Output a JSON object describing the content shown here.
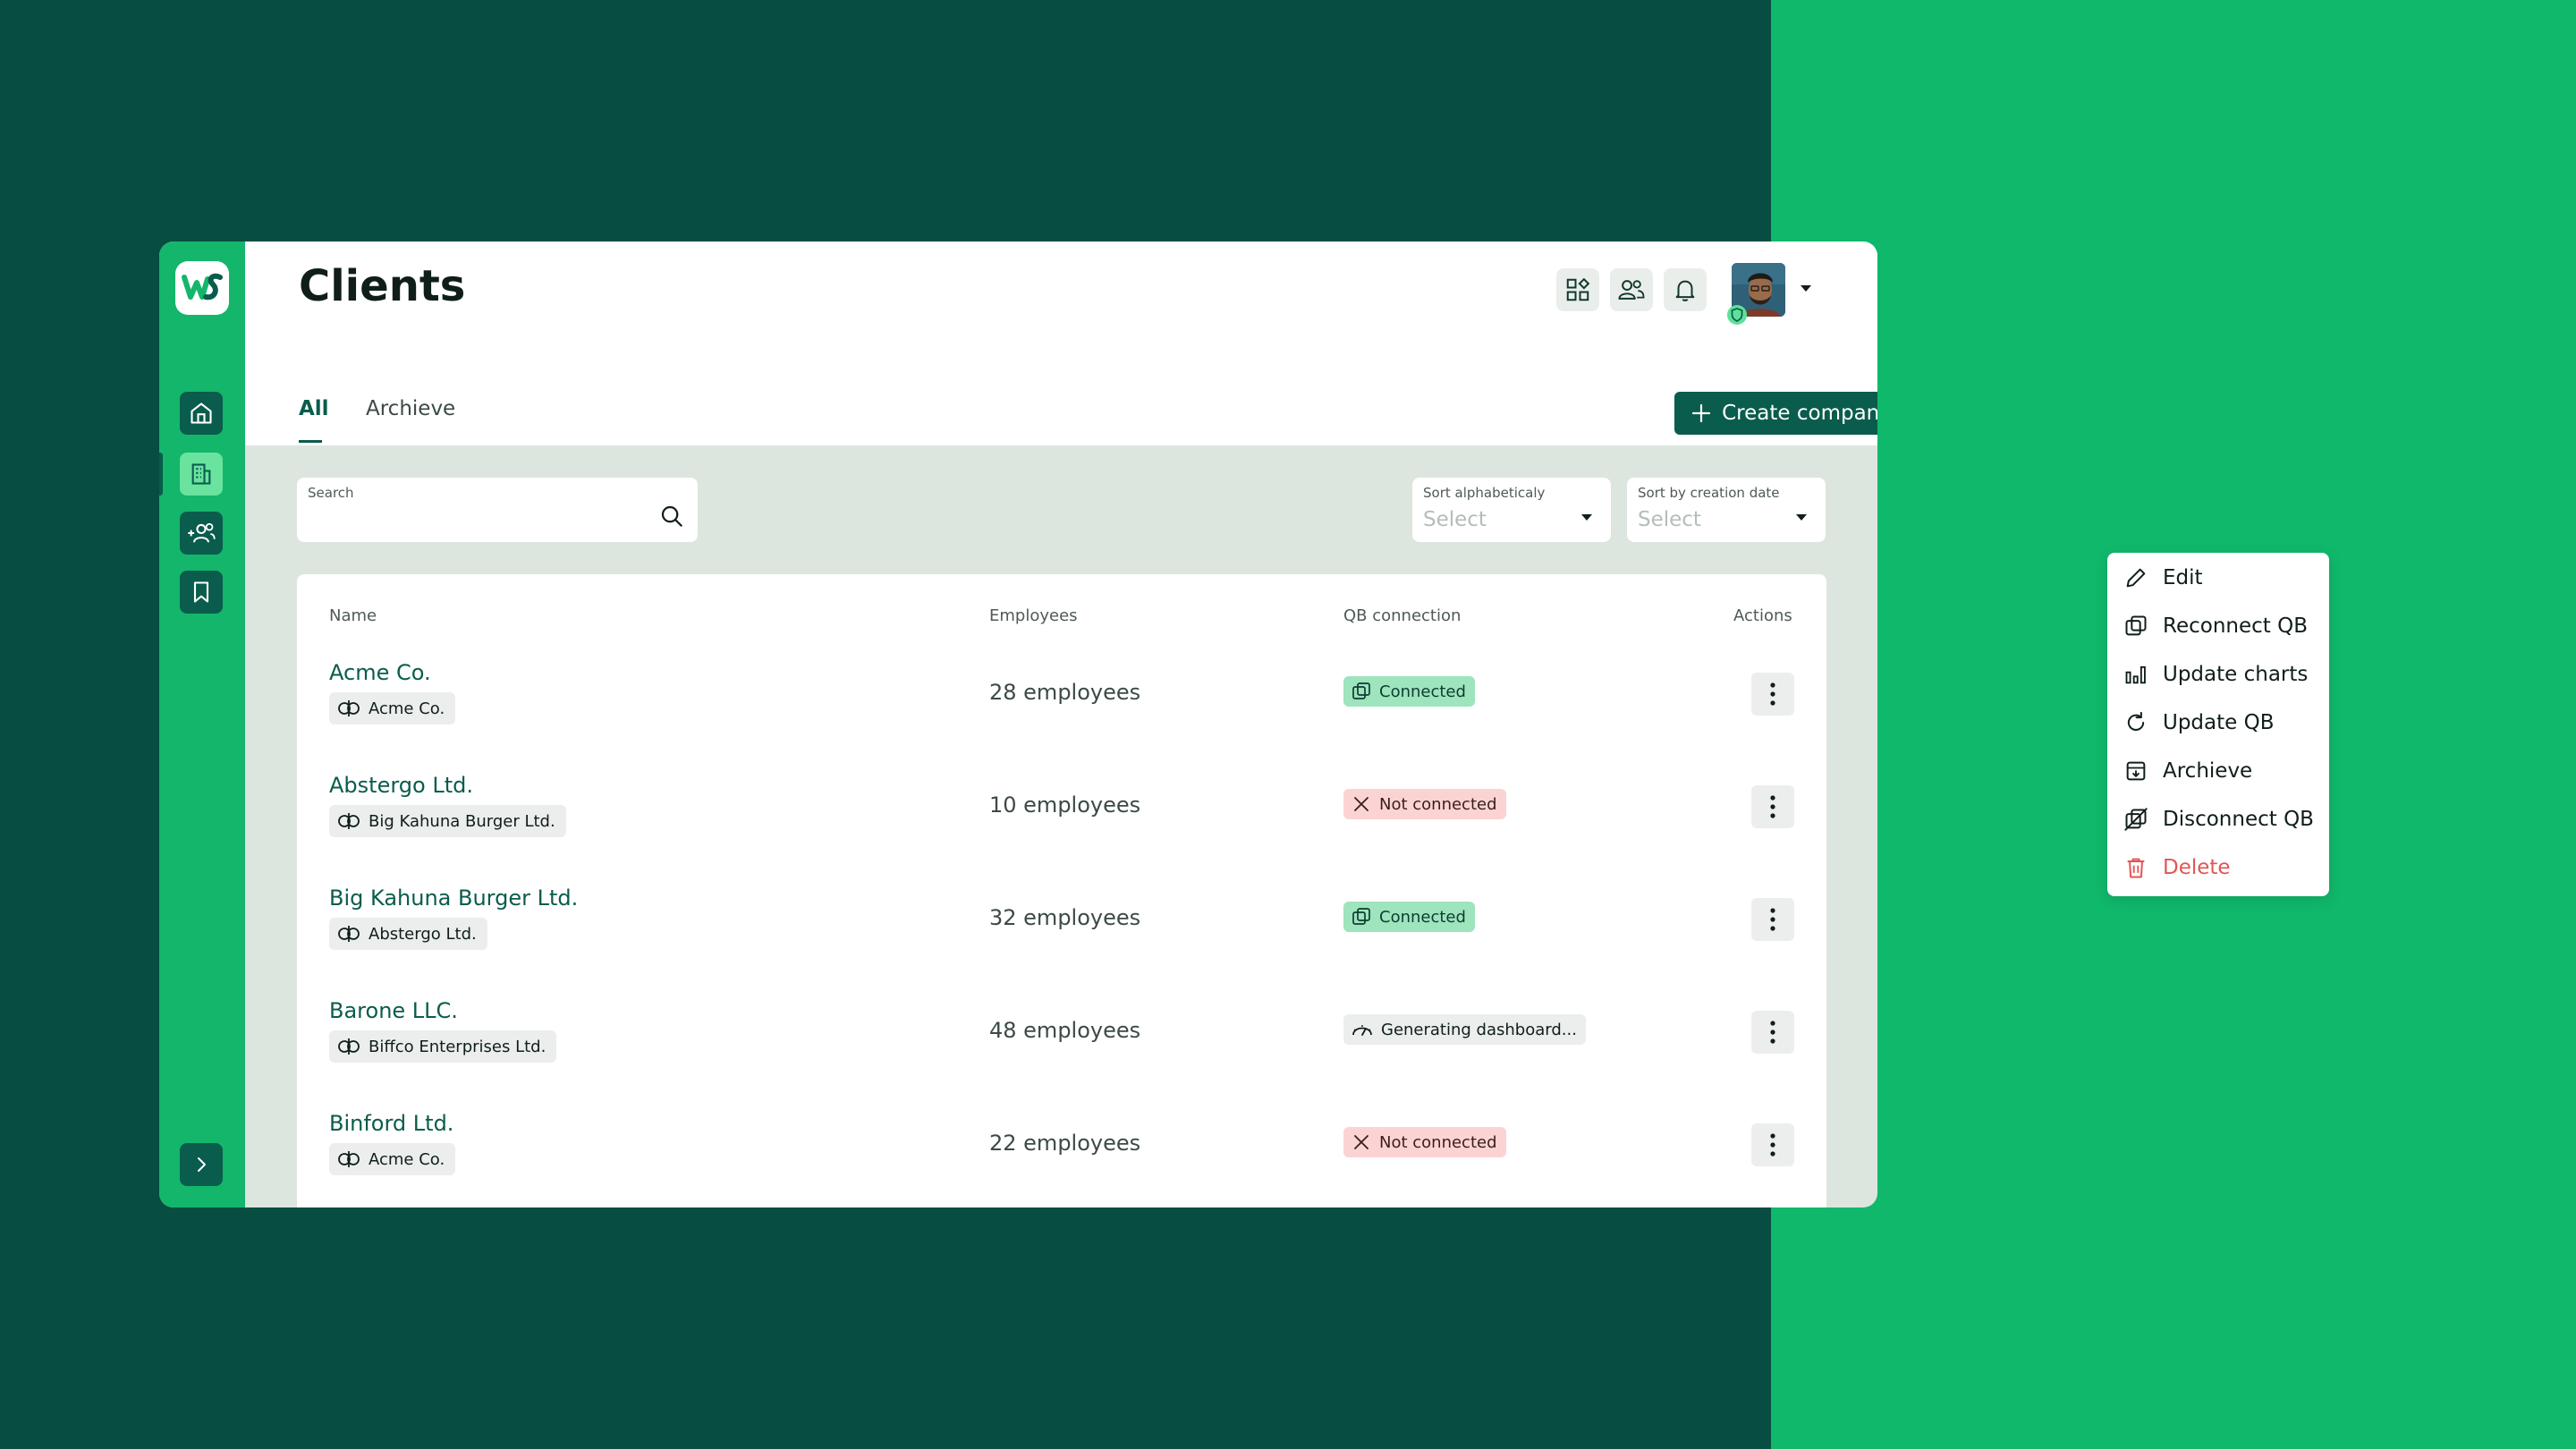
{
  "page": {
    "title": "Clients"
  },
  "header": {
    "icons": [
      "apps-icon",
      "users-icon",
      "bell-icon"
    ],
    "avatar_icon": "user-avatar",
    "avatar_badge_icon": "shield-icon"
  },
  "sidebar": {
    "logo_icon": "ws-logo",
    "items": [
      {
        "name": "home",
        "icon": "home-icon",
        "active": false
      },
      {
        "name": "companies",
        "icon": "building-icon",
        "active": true
      },
      {
        "name": "add-users",
        "icon": "add-users-icon",
        "active": false
      },
      {
        "name": "bookmarks",
        "icon": "bookmark-icon",
        "active": false
      }
    ],
    "expand_icon": "chevron-right-icon"
  },
  "tabs": [
    {
      "label": "All",
      "active": true
    },
    {
      "label": "Archieve",
      "active": false
    }
  ],
  "actions": {
    "create_label": "Create company"
  },
  "filters": {
    "search": {
      "label": "Search",
      "value": ""
    },
    "sort_alpha": {
      "label": "Sort alphabeticaly",
      "value": "Select"
    },
    "sort_date": {
      "label": "Sort by creation date",
      "value": "Select"
    }
  },
  "table": {
    "columns": [
      "Name",
      "Employees",
      "QB connection",
      "Actions"
    ],
    "rows": [
      {
        "name": "Acme Co.",
        "qb_company": "Acme Co.",
        "employees": "28 employees",
        "status": "Connected",
        "status_type": "connected"
      },
      {
        "name": "Abstergo Ltd.",
        "qb_company": "Big Kahuna Burger Ltd.",
        "employees": "10 employees",
        "status": "Not connected",
        "status_type": "not"
      },
      {
        "name": "Big Kahuna Burger Ltd.",
        "qb_company": "Abstergo Ltd.",
        "employees": "32 employees",
        "status": "Connected",
        "status_type": "connected"
      },
      {
        "name": "Barone LLC.",
        "qb_company": "Biffco Enterprises Ltd.",
        "employees": "48 employees",
        "status": "Generating dashboard...",
        "status_type": "gen"
      },
      {
        "name": "Binford Ltd.",
        "qb_company": "Acme Co.",
        "employees": "22 employees",
        "status": "Not connected",
        "status_type": "not"
      }
    ]
  },
  "context_menu": {
    "items": [
      {
        "label": "Edit",
        "icon": "pencil-icon"
      },
      {
        "label": "Reconnect QB",
        "icon": "reconnect-icon"
      },
      {
        "label": "Update charts",
        "icon": "chart-icon"
      },
      {
        "label": "Update QB",
        "icon": "refresh-icon"
      },
      {
        "label": "Archieve",
        "icon": "archive-icon"
      },
      {
        "label": "Disconnect QB",
        "icon": "disconnect-icon"
      },
      {
        "label": "Delete",
        "icon": "trash-icon",
        "danger": true
      }
    ]
  },
  "colors": {
    "dark_green": "#074d41",
    "brand_green": "#13b66b",
    "accent": "#0a5c4c",
    "connected_bg": "#9ee4bd",
    "not_connected_bg": "#fcd3d3",
    "danger": "#e25555"
  }
}
